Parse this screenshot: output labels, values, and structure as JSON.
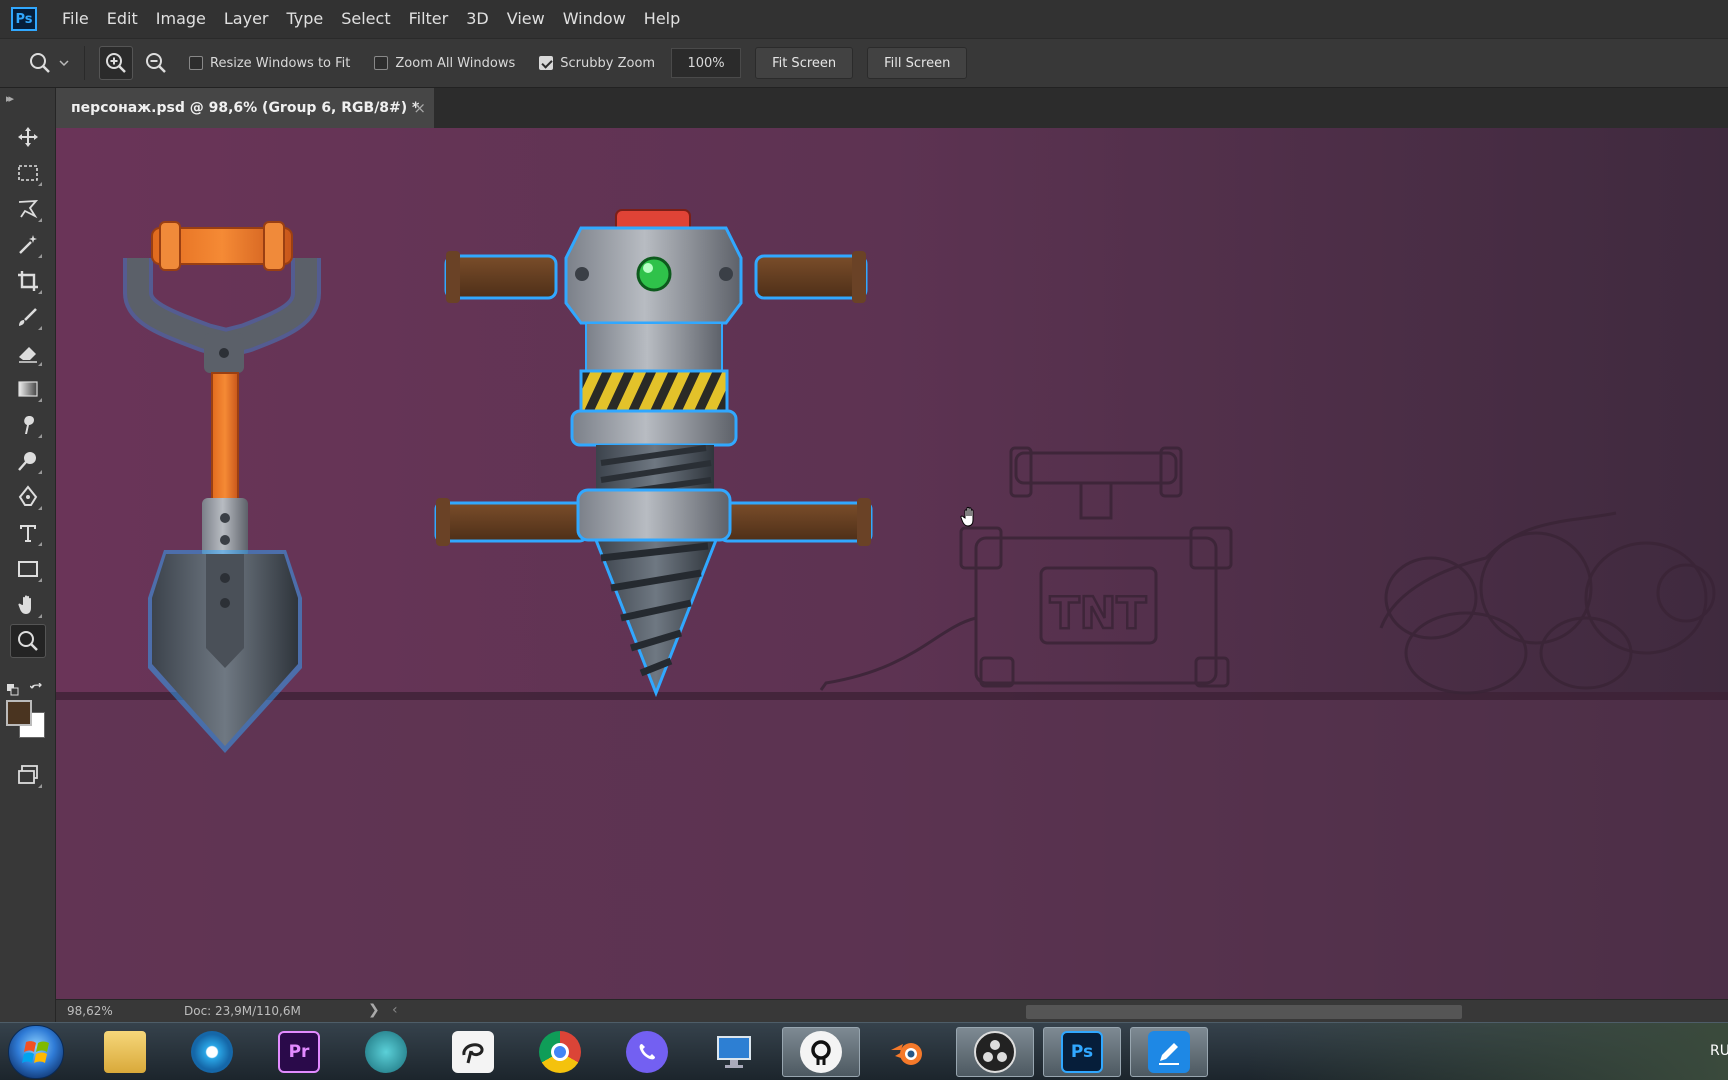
{
  "app": {
    "logo_text": "Ps"
  },
  "menu": [
    "File",
    "Edit",
    "Image",
    "Layer",
    "Type",
    "Select",
    "Filter",
    "3D",
    "View",
    "Window",
    "Help"
  ],
  "options": {
    "resize_windows_label": "Resize Windows to Fit",
    "resize_windows_checked": false,
    "zoom_all_label": "Zoom All Windows",
    "zoom_all_checked": false,
    "scrubby_zoom_label": "Scrubby Zoom",
    "scrubby_zoom_checked": true,
    "zoom_value": "100%",
    "fit_screen_label": "Fit Screen",
    "fill_screen_label": "Fill Screen"
  },
  "document": {
    "tab_title": "персонаж.psd @ 98,6% (Group 6, RGB/8#) *",
    "close_glyph": "×"
  },
  "tools": [
    "move-tool",
    "rectangular-marquee-tool",
    "polygonal-lasso-tool",
    "magic-wand-tool",
    "crop-tool",
    "brush-tool",
    "eraser-tool",
    "gradient-tool",
    "smudge-tool",
    "dodge-tool",
    "pen-tool",
    "type-tool",
    "rectangle-tool",
    "hand-tool",
    "zoom-tool"
  ],
  "active_tool": "zoom-tool",
  "colors": {
    "foreground": "#4a3420",
    "background": "#ffffff",
    "canvas": "#5e3450",
    "accent": "#31a8ff"
  },
  "canvas": {
    "tnt_label": "TNT"
  },
  "status": {
    "zoom": "98,62%",
    "doc_size": "Doc: 23,9M/110,6M",
    "arrow": "❯",
    "scroll_left": "‹"
  },
  "taskbar": {
    "apps": [
      "windows-start",
      "file-explorer",
      "camera-app",
      "premiere-pro",
      "audio-app",
      "clip-studio",
      "chrome",
      "viber",
      "remote-desktop",
      "krita-app",
      "blender",
      "obs-studio",
      "photoshop",
      "sketchbook"
    ],
    "open_apps": [
      "krita-app",
      "obs-studio",
      "photoshop",
      "sketchbook"
    ],
    "premiere_label": "Pr",
    "photoshop_label": "Ps",
    "language": "RU"
  }
}
